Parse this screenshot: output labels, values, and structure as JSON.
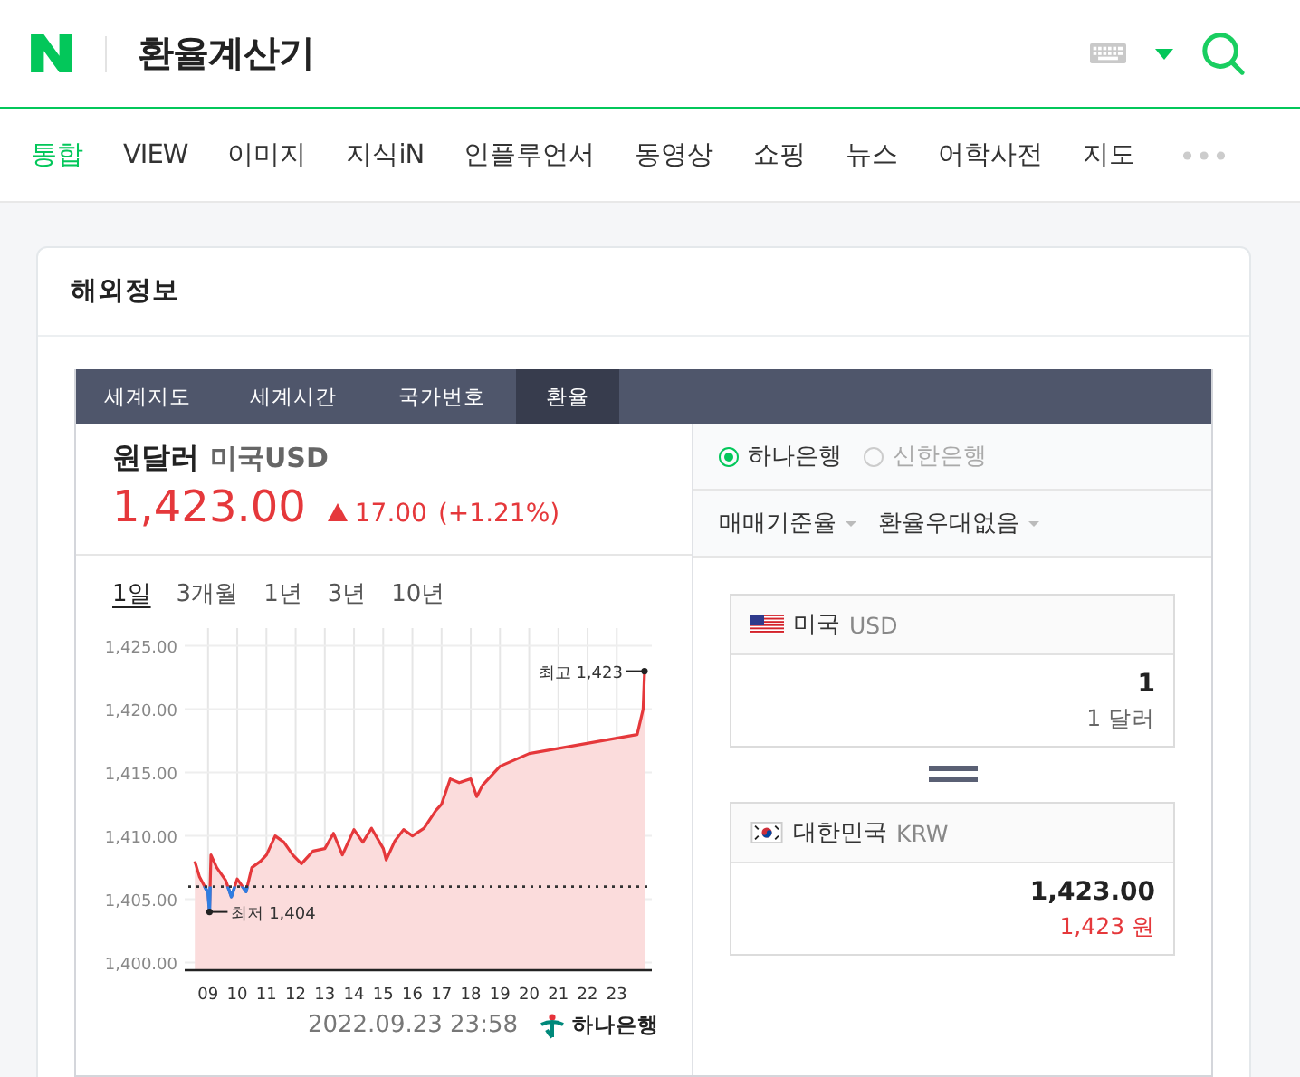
{
  "header": {
    "title": "환율계산기"
  },
  "nav": [
    {
      "label": "통합",
      "selected": true
    },
    {
      "label": "VIEW",
      "selected": false
    },
    {
      "label": "이미지",
      "selected": false
    },
    {
      "label": "지식iN",
      "selected": false
    },
    {
      "label": "인플루언서",
      "selected": false
    },
    {
      "label": "동영상",
      "selected": false
    },
    {
      "label": "쇼핑",
      "selected": false
    },
    {
      "label": "뉴스",
      "selected": false
    },
    {
      "label": "어학사전",
      "selected": false
    },
    {
      "label": "지도",
      "selected": false
    }
  ],
  "card": {
    "title": "해외정보",
    "tabs": [
      {
        "label": "세계지도",
        "selected": false
      },
      {
        "label": "세계시간",
        "selected": false
      },
      {
        "label": "국가번호",
        "selected": false
      },
      {
        "label": "환율",
        "selected": true
      }
    ],
    "quote": {
      "name": "원달러",
      "currency": "미국USD",
      "price": "1,423.00",
      "change": "17.00",
      "change_pct": "(+1.21%)"
    },
    "periods": [
      {
        "label": "1일",
        "selected": true
      },
      {
        "label": "3개월",
        "selected": false
      },
      {
        "label": "1년",
        "selected": false
      },
      {
        "label": "3년",
        "selected": false
      },
      {
        "label": "10년",
        "selected": false
      }
    ],
    "chart_data": {
      "type": "area",
      "grid": true,
      "x": [
        8.55,
        8.7,
        9.0,
        9.05,
        9.1,
        9.3,
        9.6,
        9.8,
        10.0,
        10.3,
        10.5,
        10.8,
        11.0,
        11.3,
        11.6,
        11.9,
        12.2,
        12.6,
        13.0,
        13.3,
        13.6,
        14.0,
        14.3,
        14.6,
        15.0,
        15.1,
        15.4,
        15.7,
        16.0,
        16.4,
        16.8,
        17.0,
        17.3,
        17.6,
        18.0,
        18.2,
        18.4,
        19.0,
        20.0,
        23.7,
        23.9,
        23.95
      ],
      "series": [
        {
          "color": "#e5383b",
          "values": [
            1408,
            1406.8,
            1405.5,
            1404,
            1408.5,
            1407.5,
            1406.5,
            1405.2,
            1406.6,
            1405.6,
            1407.5,
            1408,
            1408.5,
            1410,
            1409.5,
            1408.5,
            1407.8,
            1408.8,
            1409,
            1410.2,
            1408.5,
            1410.5,
            1409.5,
            1410.6,
            1409,
            1408.1,
            1409.6,
            1410.5,
            1410,
            1410.6,
            1412,
            1412.5,
            1414.5,
            1414.2,
            1414.5,
            1413.1,
            1414,
            1415.5,
            1416.5,
            1418,
            1420,
            1423
          ]
        }
      ],
      "xlim": [
        8.2,
        24.2
      ],
      "ylim": [
        1399.4,
        1426.4
      ],
      "xticks": [
        {
          "value": 9,
          "label": "09"
        },
        {
          "value": 10,
          "label": "10"
        },
        {
          "value": 11,
          "label": "11"
        },
        {
          "value": 12,
          "label": "12"
        },
        {
          "value": 13,
          "label": "13"
        },
        {
          "value": 14,
          "label": "14"
        },
        {
          "value": 15,
          "label": "15"
        },
        {
          "value": 16,
          "label": "16"
        },
        {
          "value": 17,
          "label": "17"
        },
        {
          "value": 18,
          "label": "18"
        },
        {
          "value": 19,
          "label": "19"
        },
        {
          "value": 20,
          "label": "20"
        },
        {
          "value": 21,
          "label": "21"
        },
        {
          "value": 22,
          "label": "22"
        },
        {
          "value": 23,
          "label": "23"
        }
      ],
      "yticks": [
        {
          "value": 1400,
          "label": "1,400.00"
        },
        {
          "value": 1405,
          "label": "1,405.00"
        },
        {
          "value": 1410,
          "label": "1,410.00"
        },
        {
          "value": 1415,
          "label": "1,415.00"
        },
        {
          "value": 1420,
          "label": "1,420.00"
        },
        {
          "value": 1425,
          "label": "1,425.00"
        }
      ],
      "ref_lines": [
        {
          "axis": "y",
          "value": 1406
        }
      ],
      "annotations": [
        {
          "x": 23.95,
          "y": 1423,
          "text": "최고 1,423"
        },
        {
          "x": 9.05,
          "y": 1404,
          "text": "최저 1,404"
        }
      ]
    },
    "timestamp": "2022.09.23 23:58",
    "source": "하나은행",
    "banks": [
      {
        "label": "하나은행",
        "selected": true
      },
      {
        "label": "신한은행",
        "selected": false
      }
    ],
    "dropdowns": [
      "매매기준율",
      "환율우대없음"
    ],
    "from": {
      "country": "미국",
      "code": "USD",
      "amount": "1",
      "amount_text": "1 달러"
    },
    "to": {
      "country": "대한민국",
      "code": "KRW",
      "amount": "1,423.00",
      "amount_text": "1,423 원"
    }
  }
}
